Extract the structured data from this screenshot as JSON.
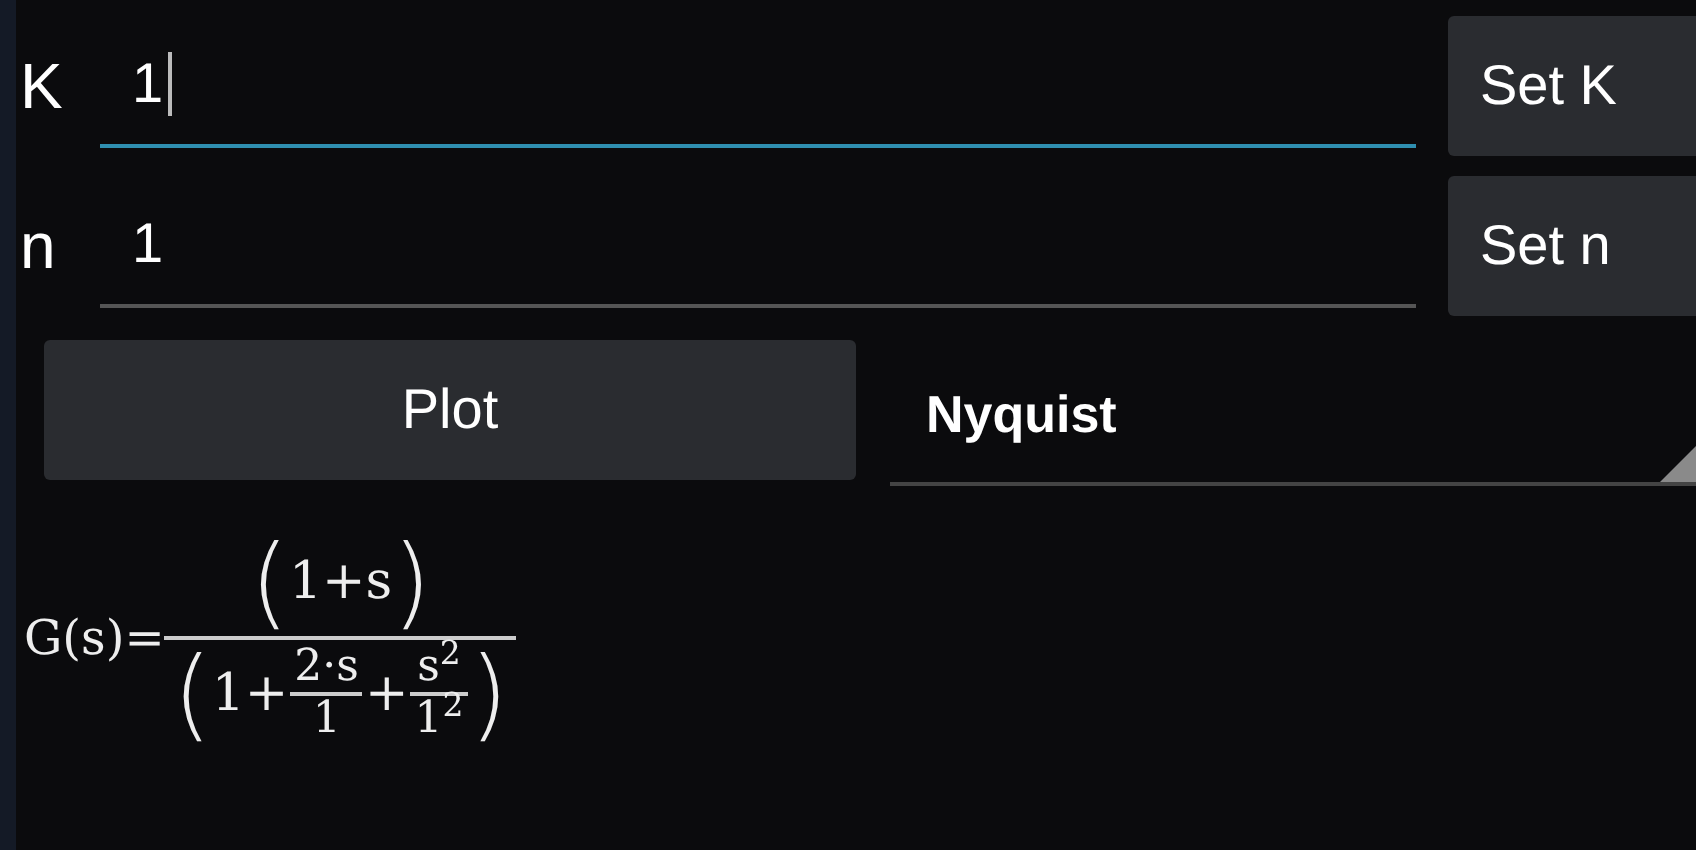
{
  "parameters": [
    {
      "label": "K",
      "value": "1",
      "focused": true,
      "button": "Set K"
    },
    {
      "label": "n",
      "value": "1",
      "focused": false,
      "button": "Set n"
    }
  ],
  "plot_button": "Plot",
  "plot_type": {
    "value": "Nyquist"
  },
  "formula": {
    "lhs": "G(s)=",
    "numerator": {
      "open": "(",
      "body": "1+s",
      "close": ")"
    },
    "denominator": {
      "open": "(",
      "close": ")",
      "terms": [
        {
          "kind": "text",
          "text": "1+"
        },
        {
          "kind": "fraction",
          "num": "2·s",
          "den": "1"
        },
        {
          "kind": "text",
          "text": "+"
        },
        {
          "kind": "fraction",
          "num": "s$^{2}$",
          "den": "1$^{2}$"
        }
      ]
    }
  }
}
